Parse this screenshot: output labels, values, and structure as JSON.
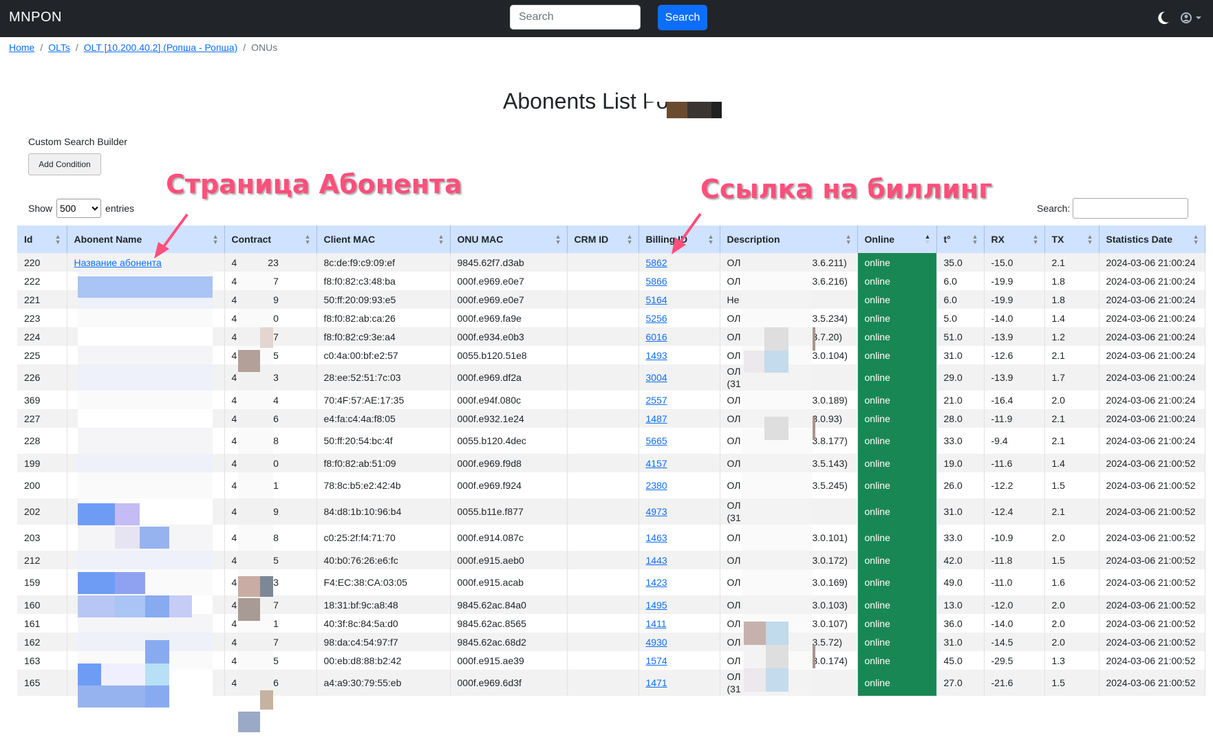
{
  "navbar": {
    "brand": "MNPON",
    "search_placeholder": "Search",
    "search_button": "Search"
  },
  "breadcrumb": {
    "home": "Home",
    "olts": "OLTs",
    "olt": "OLT [10.200.40.2] (Ропша - Ропша)",
    "current": "ONUs"
  },
  "page_title": "Abonents List Ропша",
  "custom_search": {
    "label": "Custom Search Builder",
    "add_condition": "Add Condition"
  },
  "length": {
    "show": "Show",
    "selected": "500",
    "entries": "entries"
  },
  "table_search": {
    "label": "Search:"
  },
  "annotations": {
    "abonent_page": "Страница Абонента",
    "billing_link": "Ссылка на биллинг"
  },
  "columns": [
    "Id",
    "Abonent Name",
    "Contract",
    "Client MAC",
    "ONU MAC",
    "CRM ID",
    "Billing ID",
    "Description",
    "Online",
    "t°",
    "RX",
    "TX",
    "Statistics Date"
  ],
  "rows": [
    {
      "id": "220",
      "name": "Название абонента",
      "contract_a": "4",
      "contract_b": "23",
      "client_mac": "8c:de:f9:c9:09:ef",
      "onu_mac": "9845.62f7.d3ab",
      "crm": "",
      "billing": "5862",
      "desc_a": "ОЛ",
      "desc_b": "3.6.211)",
      "online": "online",
      "t": "35.0",
      "rx": "-15.0",
      "tx": "2.1",
      "date": "2024-03-06 21:00:24"
    },
    {
      "id": "222",
      "name": "",
      "contract_a": "4",
      "contract_b": "27",
      "client_mac": "f8:f0:82:c3:48:ba",
      "onu_mac": "000f.e969.e0e7",
      "crm": "",
      "billing": "5866",
      "desc_a": "ОЛ",
      "desc_b": "3.6.216)",
      "online": "online",
      "t": "6.0",
      "rx": "-19.9",
      "tx": "1.8",
      "date": "2024-03-06 21:00:24"
    },
    {
      "id": "221",
      "name": "",
      "contract_a": "4",
      "contract_b": "29",
      "client_mac": "50:ff:20:09:93:e5",
      "onu_mac": "000f.e969.e0e7",
      "crm": "",
      "billing": "5164",
      "desc_a": "Не",
      "desc_b": "",
      "online": "online",
      "t": "6.0",
      "rx": "-19.9",
      "tx": "1.8",
      "date": "2024-03-06 21:00:24"
    },
    {
      "id": "223",
      "name": "",
      "contract_a": "4",
      "contract_b": "20",
      "client_mac": "f8:f0:82:ab:ca:26",
      "onu_mac": "000f.e969.fa9e",
      "crm": "",
      "billing": "5256",
      "desc_a": "ОЛ",
      "desc_b": "3.5.234)",
      "online": "online",
      "t": "5.0",
      "rx": "-14.0",
      "tx": "1.4",
      "date": "2024-03-06 21:00:24"
    },
    {
      "id": "224",
      "name": "",
      "contract_a": "4",
      "contract_b": "77",
      "client_mac": "f8:f0:82:c9:3e:a4",
      "onu_mac": "000f.e934.e0b3",
      "crm": "",
      "billing": "6016",
      "desc_a": "ОЛ",
      "desc_b": "3.7.20)",
      "online": "online",
      "t": "51.0",
      "rx": "-13.9",
      "tx": "1.2",
      "date": "2024-03-06 21:00:24"
    },
    {
      "id": "225",
      "name": "",
      "contract_a": "4",
      "contract_b": "45",
      "client_mac": "c0:4a:00:bf:e2:57",
      "onu_mac": "0055.b120.51e8",
      "crm": "",
      "billing": "1493",
      "desc_a": "ОЛ",
      "desc_b": "3.0.104)",
      "online": "online",
      "t": "31.0",
      "rx": "-12.6",
      "tx": "2.1",
      "date": "2024-03-06 21:00:24"
    },
    {
      "id": "226",
      "name": "",
      "contract_a": "4",
      "contract_b": "43",
      "client_mac": "28:ee:52:51:7c:03",
      "onu_mac": "000f.e969.df2a",
      "crm": "",
      "billing": "3004",
      "desc_a": "ОЛ",
      "desc_a2": "(31",
      "desc_b": "",
      "online": "online",
      "t": "29.0",
      "rx": "-13.9",
      "tx": "1.7",
      "date": "2024-03-06 21:00:24",
      "tall": true
    },
    {
      "id": "369",
      "name": "",
      "contract_a": "4",
      "contract_b": "34",
      "client_mac": "70:4F:57:AE:17:35",
      "onu_mac": "000f.e94f.080c",
      "crm": "",
      "billing": "2557",
      "desc_a": "ОЛ",
      "desc_b": "3.0.189)",
      "online": "online",
      "t": "21.0",
      "rx": "-16.4",
      "tx": "2.0",
      "date": "2024-03-06 21:00:24"
    },
    {
      "id": "227",
      "name": "",
      "contract_a": "4",
      "contract_b": "36",
      "client_mac": "e4:fa:c4:4a:f8:05",
      "onu_mac": "000f.e932.1e24",
      "crm": "",
      "billing": "1487",
      "desc_a": "ОЛ",
      "desc_b": "3.0.93)",
      "online": "online",
      "t": "28.0",
      "rx": "-11.9",
      "tx": "2.1",
      "date": "2024-03-06 21:00:24"
    },
    {
      "id": "228",
      "name": "",
      "contract_a": "4",
      "contract_b": "28",
      "client_mac": "50:ff:20:54:bc:4f",
      "onu_mac": "0055.b120.4dec",
      "crm": "",
      "billing": "5665",
      "desc_a": "ОЛ",
      "desc_b": "3.8.177)",
      "online": "online",
      "t": "33.0",
      "rx": "-9.4",
      "tx": "2.1",
      "date": "2024-03-06 21:00:24",
      "tall": true
    },
    {
      "id": "199",
      "name": "",
      "contract_a": "4",
      "contract_b": "40",
      "client_mac": "f8:f0:82:ab:51:09",
      "onu_mac": "000f.e969.f9d8",
      "crm": "",
      "billing": "4157",
      "desc_a": "ОЛ",
      "desc_b": "3.5.143)",
      "online": "online",
      "t": "19.0",
      "rx": "-11.6",
      "tx": "1.4",
      "date": "2024-03-06 21:00:52"
    },
    {
      "id": "200",
      "name": "",
      "contract_a": "4",
      "contract_b": "01",
      "client_mac": "78:8c:b5:e2:42:4b",
      "onu_mac": "000f.e969.f924",
      "crm": "",
      "billing": "2380",
      "desc_a": "ОЛ",
      "desc_b": "3.5.245)",
      "online": "online",
      "t": "26.0",
      "rx": "-12.2",
      "tx": "1.5",
      "date": "2024-03-06 21:00:52",
      "tall": true
    },
    {
      "id": "202",
      "name": "",
      "contract_a": "4",
      "contract_b": "39",
      "client_mac": "84:d8:1b:10:96:b4",
      "onu_mac": "0055.b11e.f877",
      "crm": "",
      "billing": "4973",
      "desc_a": "ОЛ",
      "desc_a2": "(31",
      "desc_b": "",
      "online": "online",
      "t": "31.0",
      "rx": "-12.4",
      "tx": "2.1",
      "date": "2024-03-06 21:00:52",
      "tall": true
    },
    {
      "id": "203",
      "name": "",
      "contract_a": "4",
      "contract_b": "08",
      "client_mac": "c0:25:2f:f4:71:70",
      "onu_mac": "000f.e914.087c",
      "crm": "",
      "billing": "1463",
      "desc_a": "ОЛ",
      "desc_b": "3.0.101)",
      "online": "online",
      "t": "33.0",
      "rx": "-10.9",
      "tx": "2.0",
      "date": "2024-03-06 21:00:52",
      "tall": true
    },
    {
      "id": "212",
      "name": "",
      "contract_a": "4",
      "contract_b": "85",
      "client_mac": "40:b0:76:26:e6:fc",
      "onu_mac": "000f.e915.aeb0",
      "crm": "",
      "billing": "1443",
      "desc_a": "ОЛ",
      "desc_b": "3.0.172)",
      "online": "online",
      "t": "42.0",
      "rx": "-11.8",
      "tx": "1.5",
      "date": "2024-03-06 21:00:52"
    },
    {
      "id": "159",
      "name": "",
      "contract_a": "4",
      "contract_b": "63",
      "client_mac": "F4:EC:38:CA:03:05",
      "onu_mac": "000f.e915.acab",
      "crm": "",
      "billing": "1423",
      "desc_a": "ОЛ",
      "desc_b": "3.0.169)",
      "online": "online",
      "t": "49.0",
      "rx": "-11.0",
      "tx": "1.6",
      "date": "2024-03-06 21:00:52",
      "tall": true
    },
    {
      "id": "160",
      "name": "",
      "contract_a": "4",
      "contract_b": "47",
      "client_mac": "18:31:bf:9c:a8:48",
      "onu_mac": "9845.62ac.84a0",
      "crm": "",
      "billing": "1495",
      "desc_a": "ОЛ",
      "desc_b": "3.0.103)",
      "online": "online",
      "t": "13.0",
      "rx": "-12.0",
      "tx": "2.0",
      "date": "2024-03-06 21:00:52"
    },
    {
      "id": "161",
      "name": "",
      "contract_a": "4",
      "contract_b": "51",
      "client_mac": "40:3f:8c:84:5a:d0",
      "onu_mac": "9845.62ac.8565",
      "crm": "",
      "billing": "1411",
      "desc_a": "ОЛ",
      "desc_b": "3.0.107)",
      "online": "online",
      "t": "36.0",
      "rx": "-14.0",
      "tx": "2.0",
      "date": "2024-03-06 21:00:52"
    },
    {
      "id": "162",
      "name": "",
      "contract_a": "4",
      "contract_b": "97",
      "client_mac": "98:da:c4:54:97:f7",
      "onu_mac": "9845.62ac.68d2",
      "crm": "",
      "billing": "4930",
      "desc_a": "ОЛ",
      "desc_b": "3.5.72)",
      "online": "online",
      "t": "31.0",
      "rx": "-14.5",
      "tx": "2.0",
      "date": "2024-03-06 21:00:52"
    },
    {
      "id": "163",
      "name": "",
      "contract_a": "4",
      "contract_b": "35",
      "client_mac": "00:eb:d8:88:b2:42",
      "onu_mac": "000f.e915.ae39",
      "crm": "",
      "billing": "1574",
      "desc_a": "ОЛ",
      "desc_b": "3.0.174)",
      "online": "online",
      "t": "45.0",
      "rx": "-29.5",
      "tx": "1.3",
      "date": "2024-03-06 21:00:52"
    },
    {
      "id": "165",
      "name": "",
      "contract_a": "4",
      "contract_b": "16",
      "client_mac": "a4:a9:30:79:55:eb",
      "onu_mac": "000f.e969.6d3f",
      "crm": "",
      "billing": "1471",
      "desc_a": "ОЛ",
      "desc_a2": "(31",
      "desc_b": "",
      "online": "online",
      "t": "27.0",
      "rx": "-21.6",
      "tx": "1.5",
      "date": "2024-03-06 21:00:52",
      "tall": true
    }
  ],
  "colors": {
    "navbar": "#212529",
    "primary": "#0d6efd",
    "header_bg": "#cfe2ff",
    "online": "#198754",
    "annotation": "#ff4f7b"
  }
}
